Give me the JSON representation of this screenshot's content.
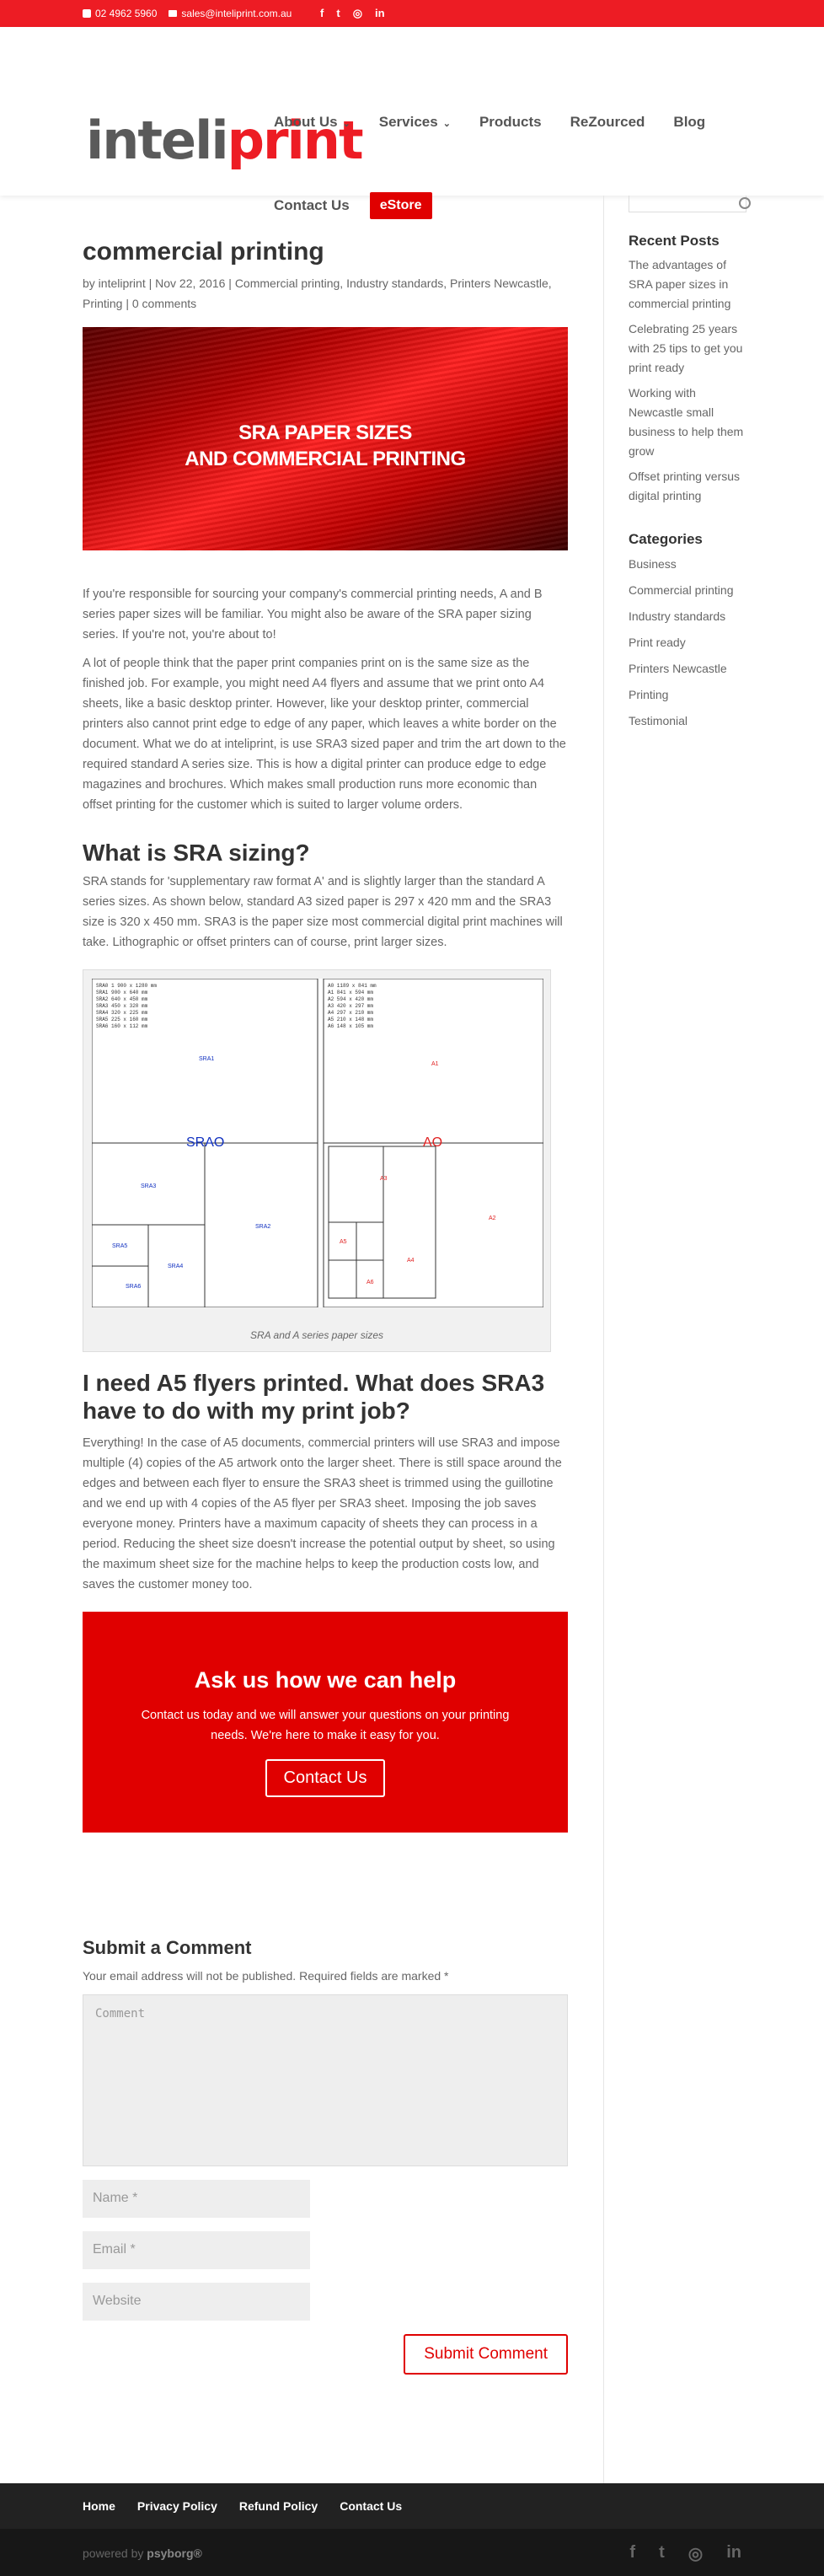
{
  "topbar": {
    "phone": "02 4962 5960",
    "email": "sales@inteliprint.com.au",
    "social": [
      "f",
      "t",
      "◎",
      "in"
    ]
  },
  "logo": {
    "grey": "inteli",
    "red": "print"
  },
  "nav": {
    "items": [
      "About Us",
      "Services",
      "Products",
      "ReZourced",
      "Blog"
    ],
    "contact": "Contact Us",
    "estore": "eStore"
  },
  "post": {
    "title": "commercial printing",
    "meta": "by inteliprint | Nov 22, 2016 | Commercial printing, Industry standards, Printers Newcastle, Printing | 0 comments",
    "hero_line1": "SRA PAPER SIZES",
    "hero_line2": "AND COMMERCIAL PRINTING",
    "p1": "If you're responsible for sourcing your company's commercial printing needs, A and B series paper sizes will be familiar. You might also be aware of the SRA paper sizing series. If you're not, you're about to!",
    "p2": "A lot of people think that the paper print companies print on is the same size as the finished job. For example, you might need A4 flyers and assume that we print onto A4 sheets, like a basic desktop printer. However, like your desktop printer, commercial printers also cannot print edge to edge of any paper, which leaves a white border on the document. What we do at inteliprint, is use SRA3 sized paper and trim the art down to the required standard A series size. This is how a digital printer can produce edge to edge magazines and brochures. Which makes small production runs more economic than offset printing for the customer which is suited to larger volume orders.",
    "h_sra": "What is SRA sizing?",
    "p3": "SRA stands for 'supplementary raw format A' and is slightly larger than the standard A series sizes. As shown below, standard A3 sized paper is 297 x 420 mm and the SRA3 size is 320 x 450 mm. SRA3 is the paper size most commercial digital print machines will take. Lithographic or offset printers can of course, print larger sizes.",
    "figure_caption": "SRA and A series paper sizes",
    "sra_table": [
      "SRA0  1 900 x 1280 mm",
      "SRA1  900 x 640 mm",
      "SRA2  640 x 450 mm",
      "SRA3  450 x 320 mm",
      "SRA4  320 x 225 mm",
      "SRA5  225 x 160 mm",
      "SRA6  160 x 112 mm"
    ],
    "a_table": [
      "A0  1189 x 841 mm",
      "A1  841 x 594 mm",
      "A2  594 x 420 mm",
      "A3  420 x 297 mm",
      "A4  297 x 210 mm",
      "A5  210 x 148 mm",
      "A6  148 x 105 mm"
    ],
    "h_a5": "I need A5 flyers printed. What does SRA3 have to do with my print job?",
    "p4": "Everything! In the case of A5 documents, commercial printers will use SRA3 and impose multiple (4) copies of the A5 artwork onto the larger sheet. There is still space around the edges and between each flyer to ensure the SRA3 sheet is trimmed using the guillotine and we end up with 4 copies of the A5 flyer per SRA3 sheet. Imposing the job saves everyone money. Printers have a maximum capacity of sheets they can process in a period. Reducing the sheet size doesn't increase the potential output by sheet, so using the maximum sheet size for the machine helps to keep the production costs low, and saves the customer money too."
  },
  "cta": {
    "title": "Ask us how we can help",
    "body": "Contact us today and we will answer your questions on your printing needs. We're here to make it easy for you.",
    "button": "Contact Us"
  },
  "comment_form": {
    "title": "Submit a Comment",
    "note": "Your email address will not be published. Required fields are marked *",
    "comment_placeholder": "Comment",
    "name_placeholder": "Name *",
    "email_placeholder": "Email *",
    "website_placeholder": "Website",
    "submit": "Submit Comment"
  },
  "sidebar": {
    "recent_title": "Recent Posts",
    "recent": [
      "The advantages of SRA paper sizes in commercial printing",
      "Celebrating 25 years with 25 tips to get you print ready",
      "Working with Newcastle small business to help them grow",
      "Offset printing versus digital printing"
    ],
    "categories_title": "Categories",
    "categories": [
      "Business",
      "Commercial printing",
      "Industry standards",
      "Print ready",
      "Printers Newcastle",
      "Printing",
      "Testimonial"
    ]
  },
  "footer": {
    "links": [
      "Home",
      "Privacy Policy",
      "Refund Policy",
      "Contact Us"
    ],
    "credit_prefix": "powered by",
    "credit_brand": "psyborg®",
    "social": [
      "f",
      "t",
      "◎",
      "in"
    ]
  },
  "colors": {
    "brand_red": "#ed1c24",
    "cta_red": "#e00000",
    "sra_blue": "#1030c0",
    "a_red": "#e02020"
  }
}
